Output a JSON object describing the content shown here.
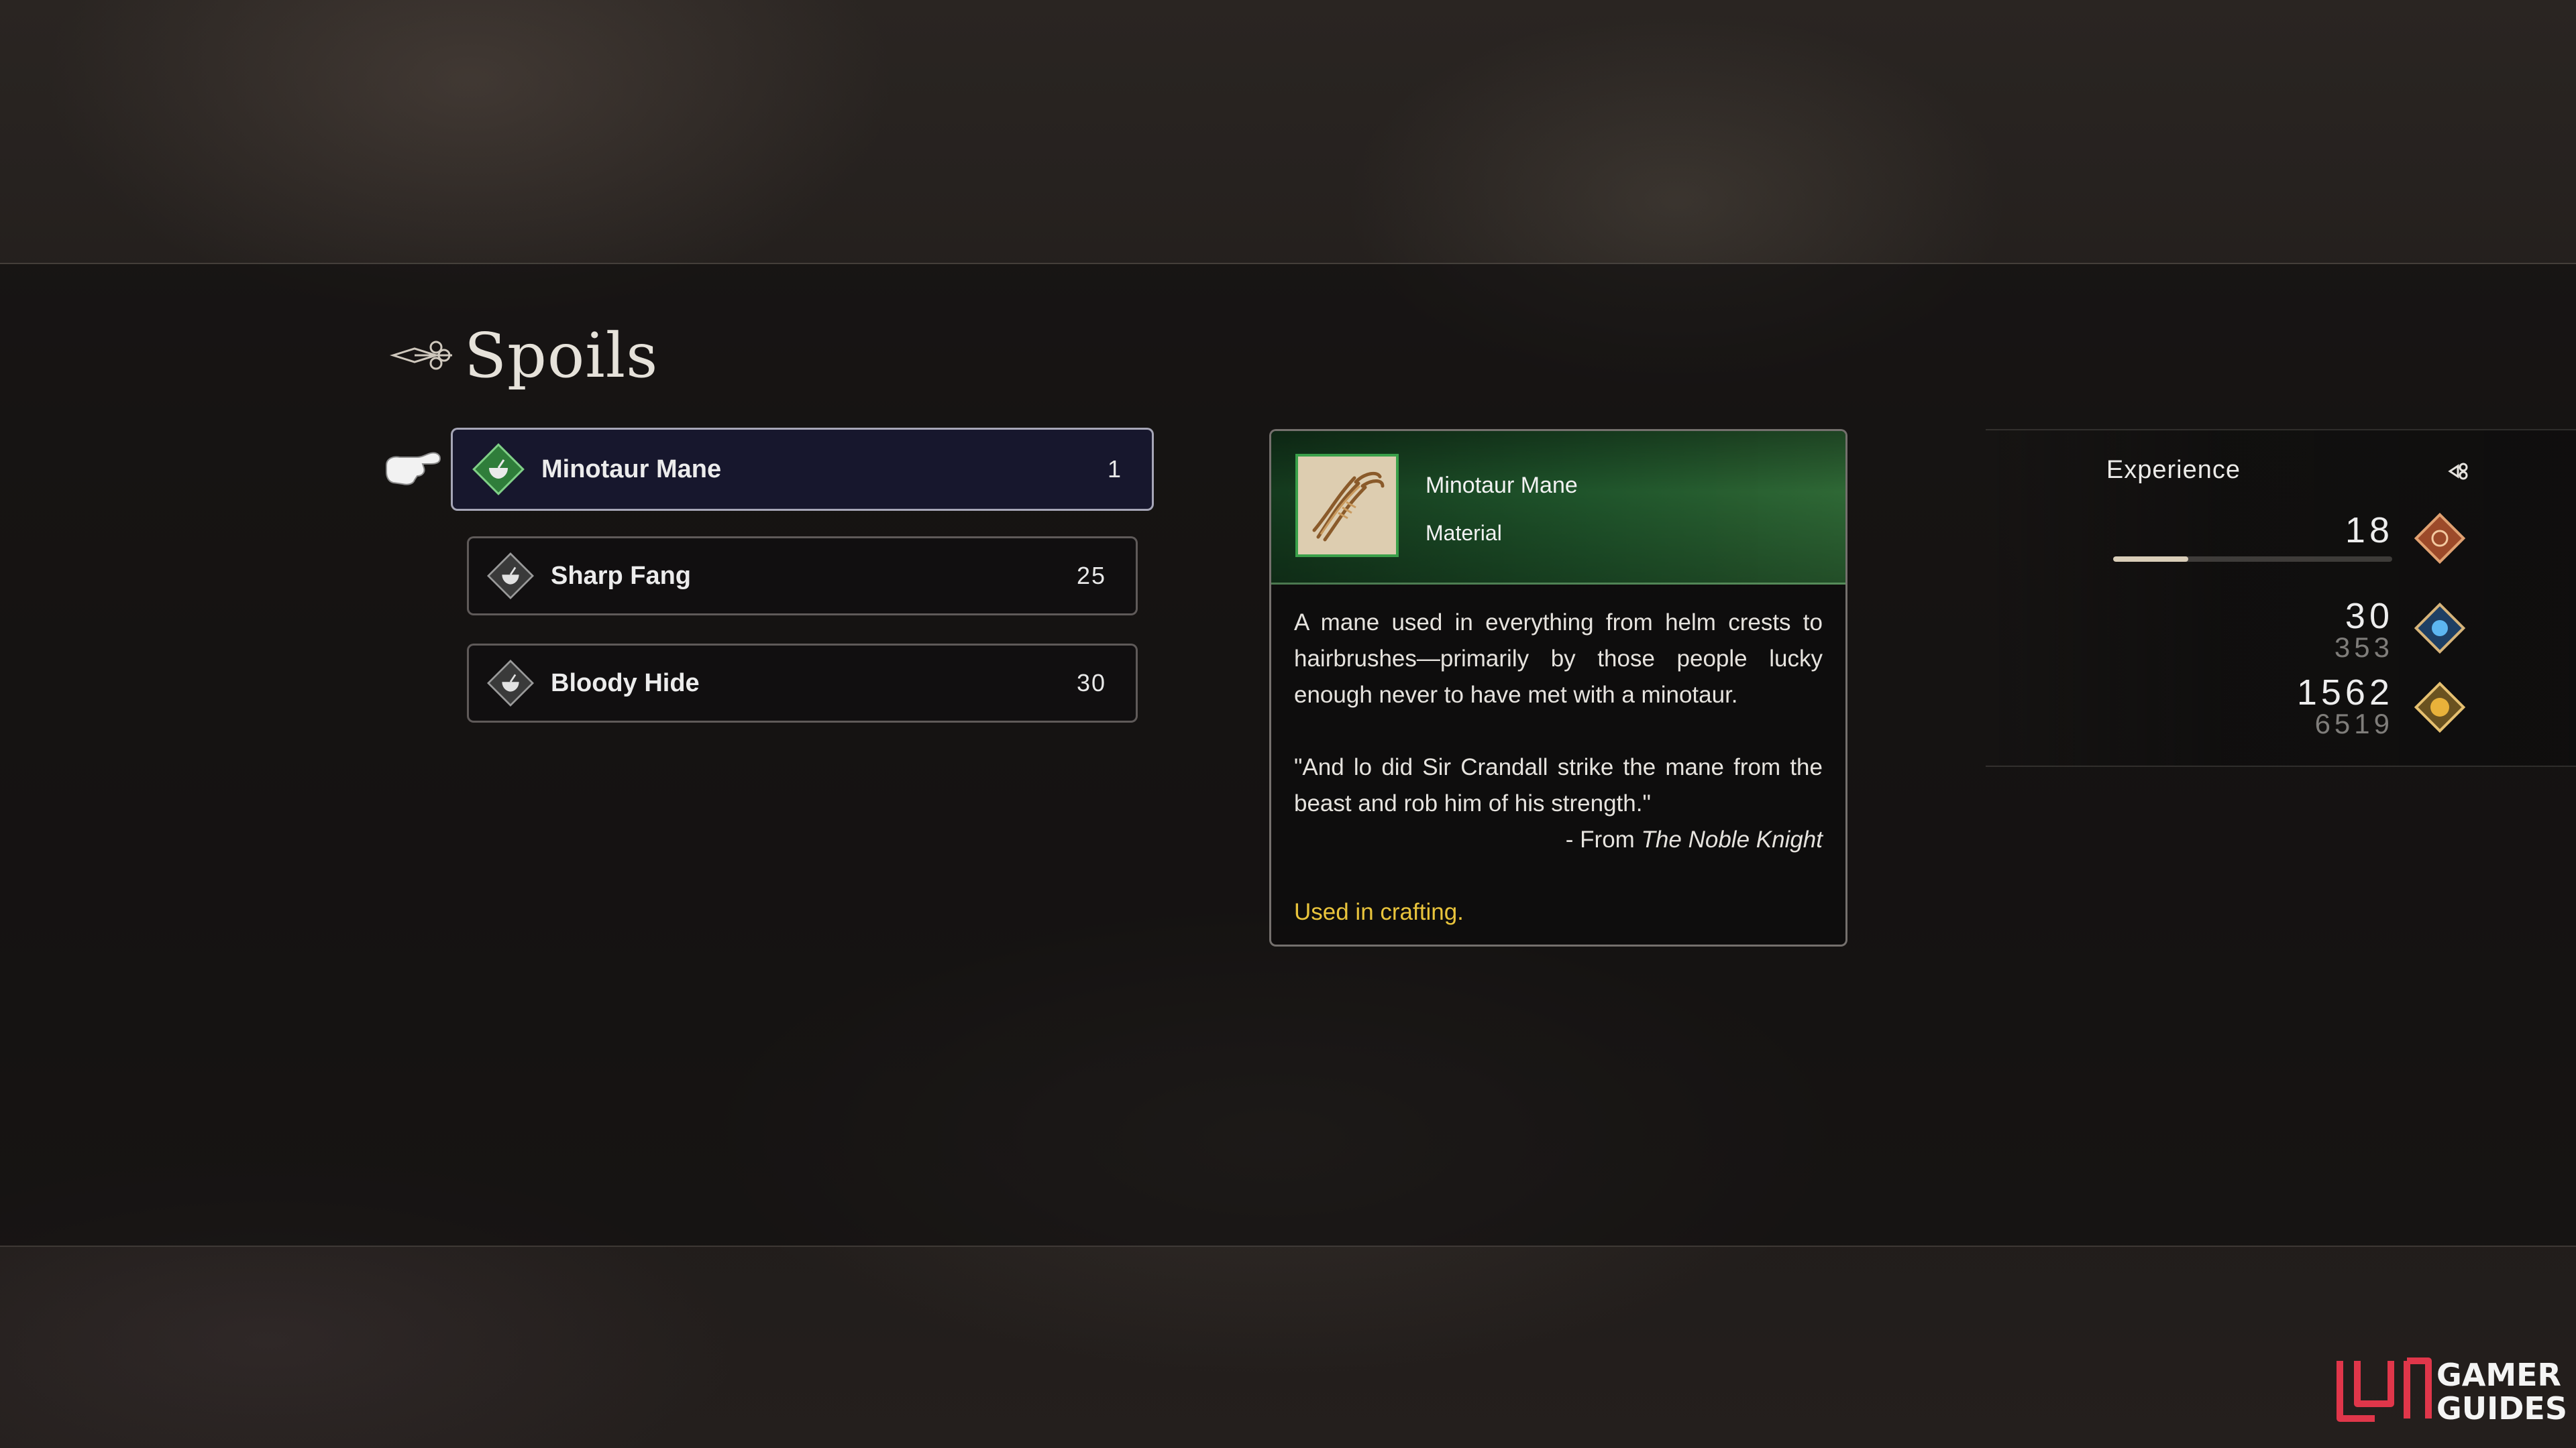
{
  "header": {
    "title": "Spoils"
  },
  "spoils": {
    "items": [
      {
        "name": "Minotaur Mane",
        "count": "1",
        "selected": true
      },
      {
        "name": "Sharp Fang",
        "count": "25",
        "selected": false
      },
      {
        "name": "Bloody Hide",
        "count": "30",
        "selected": false
      }
    ]
  },
  "detail": {
    "name": "Minotaur Mane",
    "type": "Material",
    "description": "A mane used in everything from helm crests to hairbrushes—primarily by those people lucky enough never to have met with a minotaur.",
    "quote": "\"And lo did Sir Crandall strike the mane from the beast and rob him of his strength.\"",
    "source_prefix": "- From ",
    "source_title": "The Noble Knight",
    "note": "Used in crafting."
  },
  "experience": {
    "label": "Experience",
    "level": "18",
    "level_progress": 0.27,
    "ability_points": {
      "gained": "30",
      "total": "353"
    },
    "gil": {
      "gained": "1562",
      "total": "6519"
    }
  },
  "watermark": {
    "line1": "GAMER",
    "line2": "GUIDES"
  },
  "colors": {
    "selected_item_bg": "#18182f",
    "detail_header_green": "#205a2c",
    "note_yellow": "#e9c43c",
    "level_gem": "#c9663a",
    "ability_gem": "#3a8fd0",
    "gil_gem": "#d7a53a"
  },
  "icons": {
    "title_ornament": "fleur-ornament-icon",
    "pointer": "pointing-hand-icon",
    "item_gem": "material-bowl-icon",
    "experience_arrow": "fleur-arrow-icon"
  }
}
